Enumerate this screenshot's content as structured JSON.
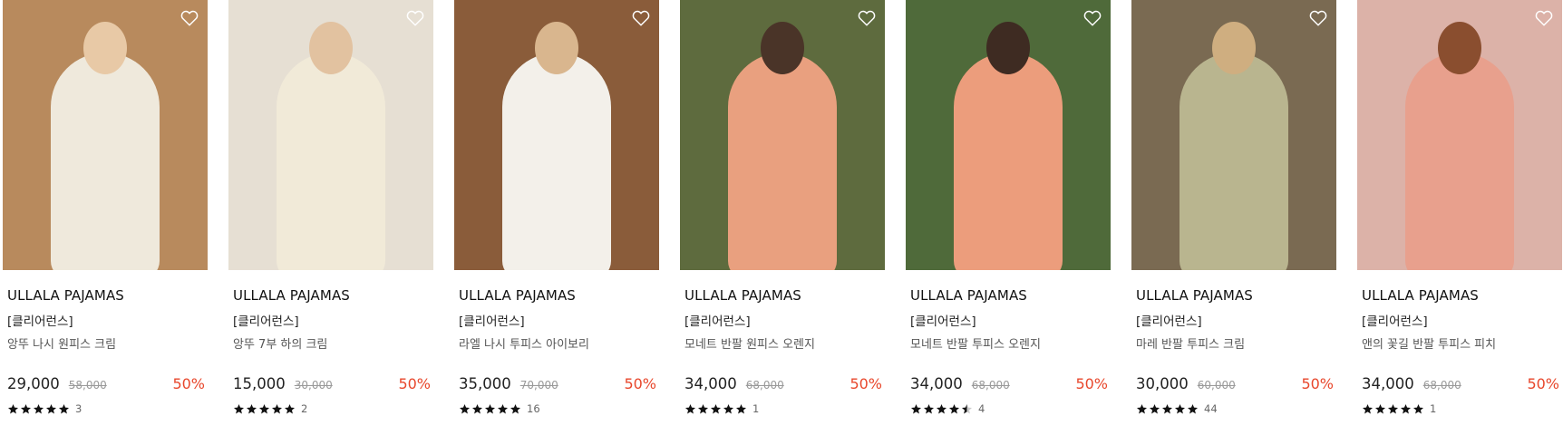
{
  "products": [
    {
      "brand": "ULLALA PAJAMAS",
      "tag": "[클리어런스]",
      "name": "앙뚜 나시 원피스 크림",
      "price": "29,000",
      "original_price": "58,000",
      "discount": "50%",
      "rating": 5,
      "review_count": "3",
      "photo_colors": {
        "bg": "#b88a5d",
        "figure": "#efe9dc",
        "head": "#e8c9a6"
      }
    },
    {
      "brand": "ULLALA PAJAMAS",
      "tag": "[클리어런스]",
      "name": "앙뚜 7부 하의 크림",
      "price": "15,000",
      "original_price": "30,000",
      "discount": "50%",
      "rating": 5,
      "review_count": "2",
      "photo_colors": {
        "bg": "#e6dfd3",
        "figure": "#f1ead8",
        "head": "#e2c2a0"
      }
    },
    {
      "brand": "ULLALA PAJAMAS",
      "tag": "[클리어런스]",
      "name": "라엘 나시 투피스 아이보리",
      "price": "35,000",
      "original_price": "70,000",
      "discount": "50%",
      "rating": 5,
      "review_count": "16",
      "photo_colors": {
        "bg": "#8a5c3a",
        "figure": "#f3f0ea",
        "head": "#d9b68e"
      }
    },
    {
      "brand": "ULLALA PAJAMAS",
      "tag": "[클리어런스]",
      "name": "모네트 반팔 원피스 오렌지",
      "price": "34,000",
      "original_price": "68,000",
      "discount": "50%",
      "rating": 5,
      "review_count": "1",
      "photo_colors": {
        "bg": "#5e6b3e",
        "figure": "#e9a07f",
        "head": "#4a3428"
      }
    },
    {
      "brand": "ULLALA PAJAMAS",
      "tag": "[클리어런스]",
      "name": "모네트 반팔 투피스 오렌지",
      "price": "34,000",
      "original_price": "68,000",
      "discount": "50%",
      "rating": 4.5,
      "review_count": "4",
      "photo_colors": {
        "bg": "#4f6a3a",
        "figure": "#ec9d7c",
        "head": "#3e2b22"
      }
    },
    {
      "brand": "ULLALA PAJAMAS",
      "tag": "[클리어런스]",
      "name": "마레 반팔 투피스 크림",
      "price": "30,000",
      "original_price": "60,000",
      "discount": "50%",
      "rating": 5,
      "review_count": "44",
      "photo_colors": {
        "bg": "#7a6a52",
        "figure": "#b9b58f",
        "head": "#cfae80"
      }
    },
    {
      "brand": "ULLALA PAJAMAS",
      "tag": "[클리어런스]",
      "name": "앤의 꽃길 반팔 투피스 피치",
      "price": "34,000",
      "original_price": "68,000",
      "discount": "50%",
      "rating": 5,
      "review_count": "1",
      "photo_colors": {
        "bg": "#dcb2a8",
        "figure": "#e8a08d",
        "head": "#8a4e2f"
      }
    }
  ],
  "colors": {
    "discount": "#e8472c",
    "star": "#111111"
  },
  "icons": {
    "wishlist": "heart-outline-icon",
    "star": "star-icon"
  }
}
